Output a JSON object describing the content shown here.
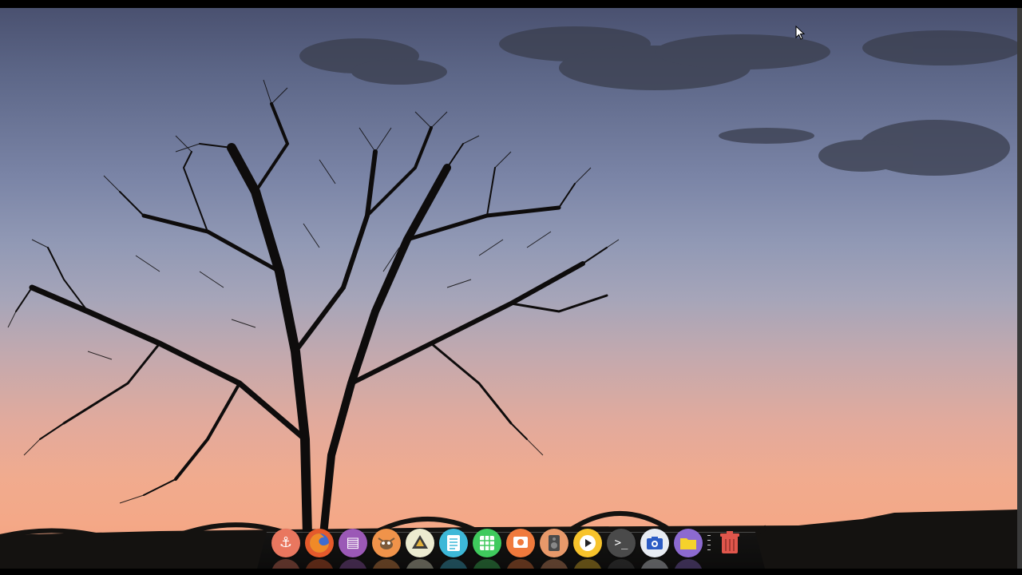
{
  "desktop": {
    "wallpaper": "tree-silhouette-sunset"
  },
  "dock": {
    "items": [
      {
        "name": "anchor-icon",
        "color": "#e9775f",
        "glyph": "⚓"
      },
      {
        "name": "firefox-icon",
        "color": "#e55a2b",
        "glyph": ""
      },
      {
        "name": "text-editor-icon",
        "color": "#9b59b6",
        "glyph": "▤"
      },
      {
        "name": "gimp-icon",
        "color": "#f0934a",
        "glyph": ""
      },
      {
        "name": "inkscape-icon",
        "color": "#ecebd0",
        "glyph": "▲"
      },
      {
        "name": "document-viewer-icon",
        "color": "#3db8d8",
        "glyph": "≡"
      },
      {
        "name": "spreadsheet-icon",
        "color": "#3fca5d",
        "glyph": "▦"
      },
      {
        "name": "presentation-icon",
        "color": "#f07a3c",
        "glyph": "▣"
      },
      {
        "name": "music-player-icon",
        "color": "#e8996a",
        "glyph": "▮"
      },
      {
        "name": "video-player-icon",
        "color": "#f7c32b",
        "glyph": "▶"
      },
      {
        "name": "terminal-icon",
        "color": "#4a4a4a",
        "glyph": ">_"
      },
      {
        "name": "screenshot-icon",
        "color": "#e8ecf3",
        "glyph": "◉"
      },
      {
        "name": "file-manager-icon",
        "color": "#8c6ad0",
        "glyph": "■"
      }
    ],
    "trash": {
      "name": "trash-icon",
      "color": "#e0564c"
    }
  }
}
